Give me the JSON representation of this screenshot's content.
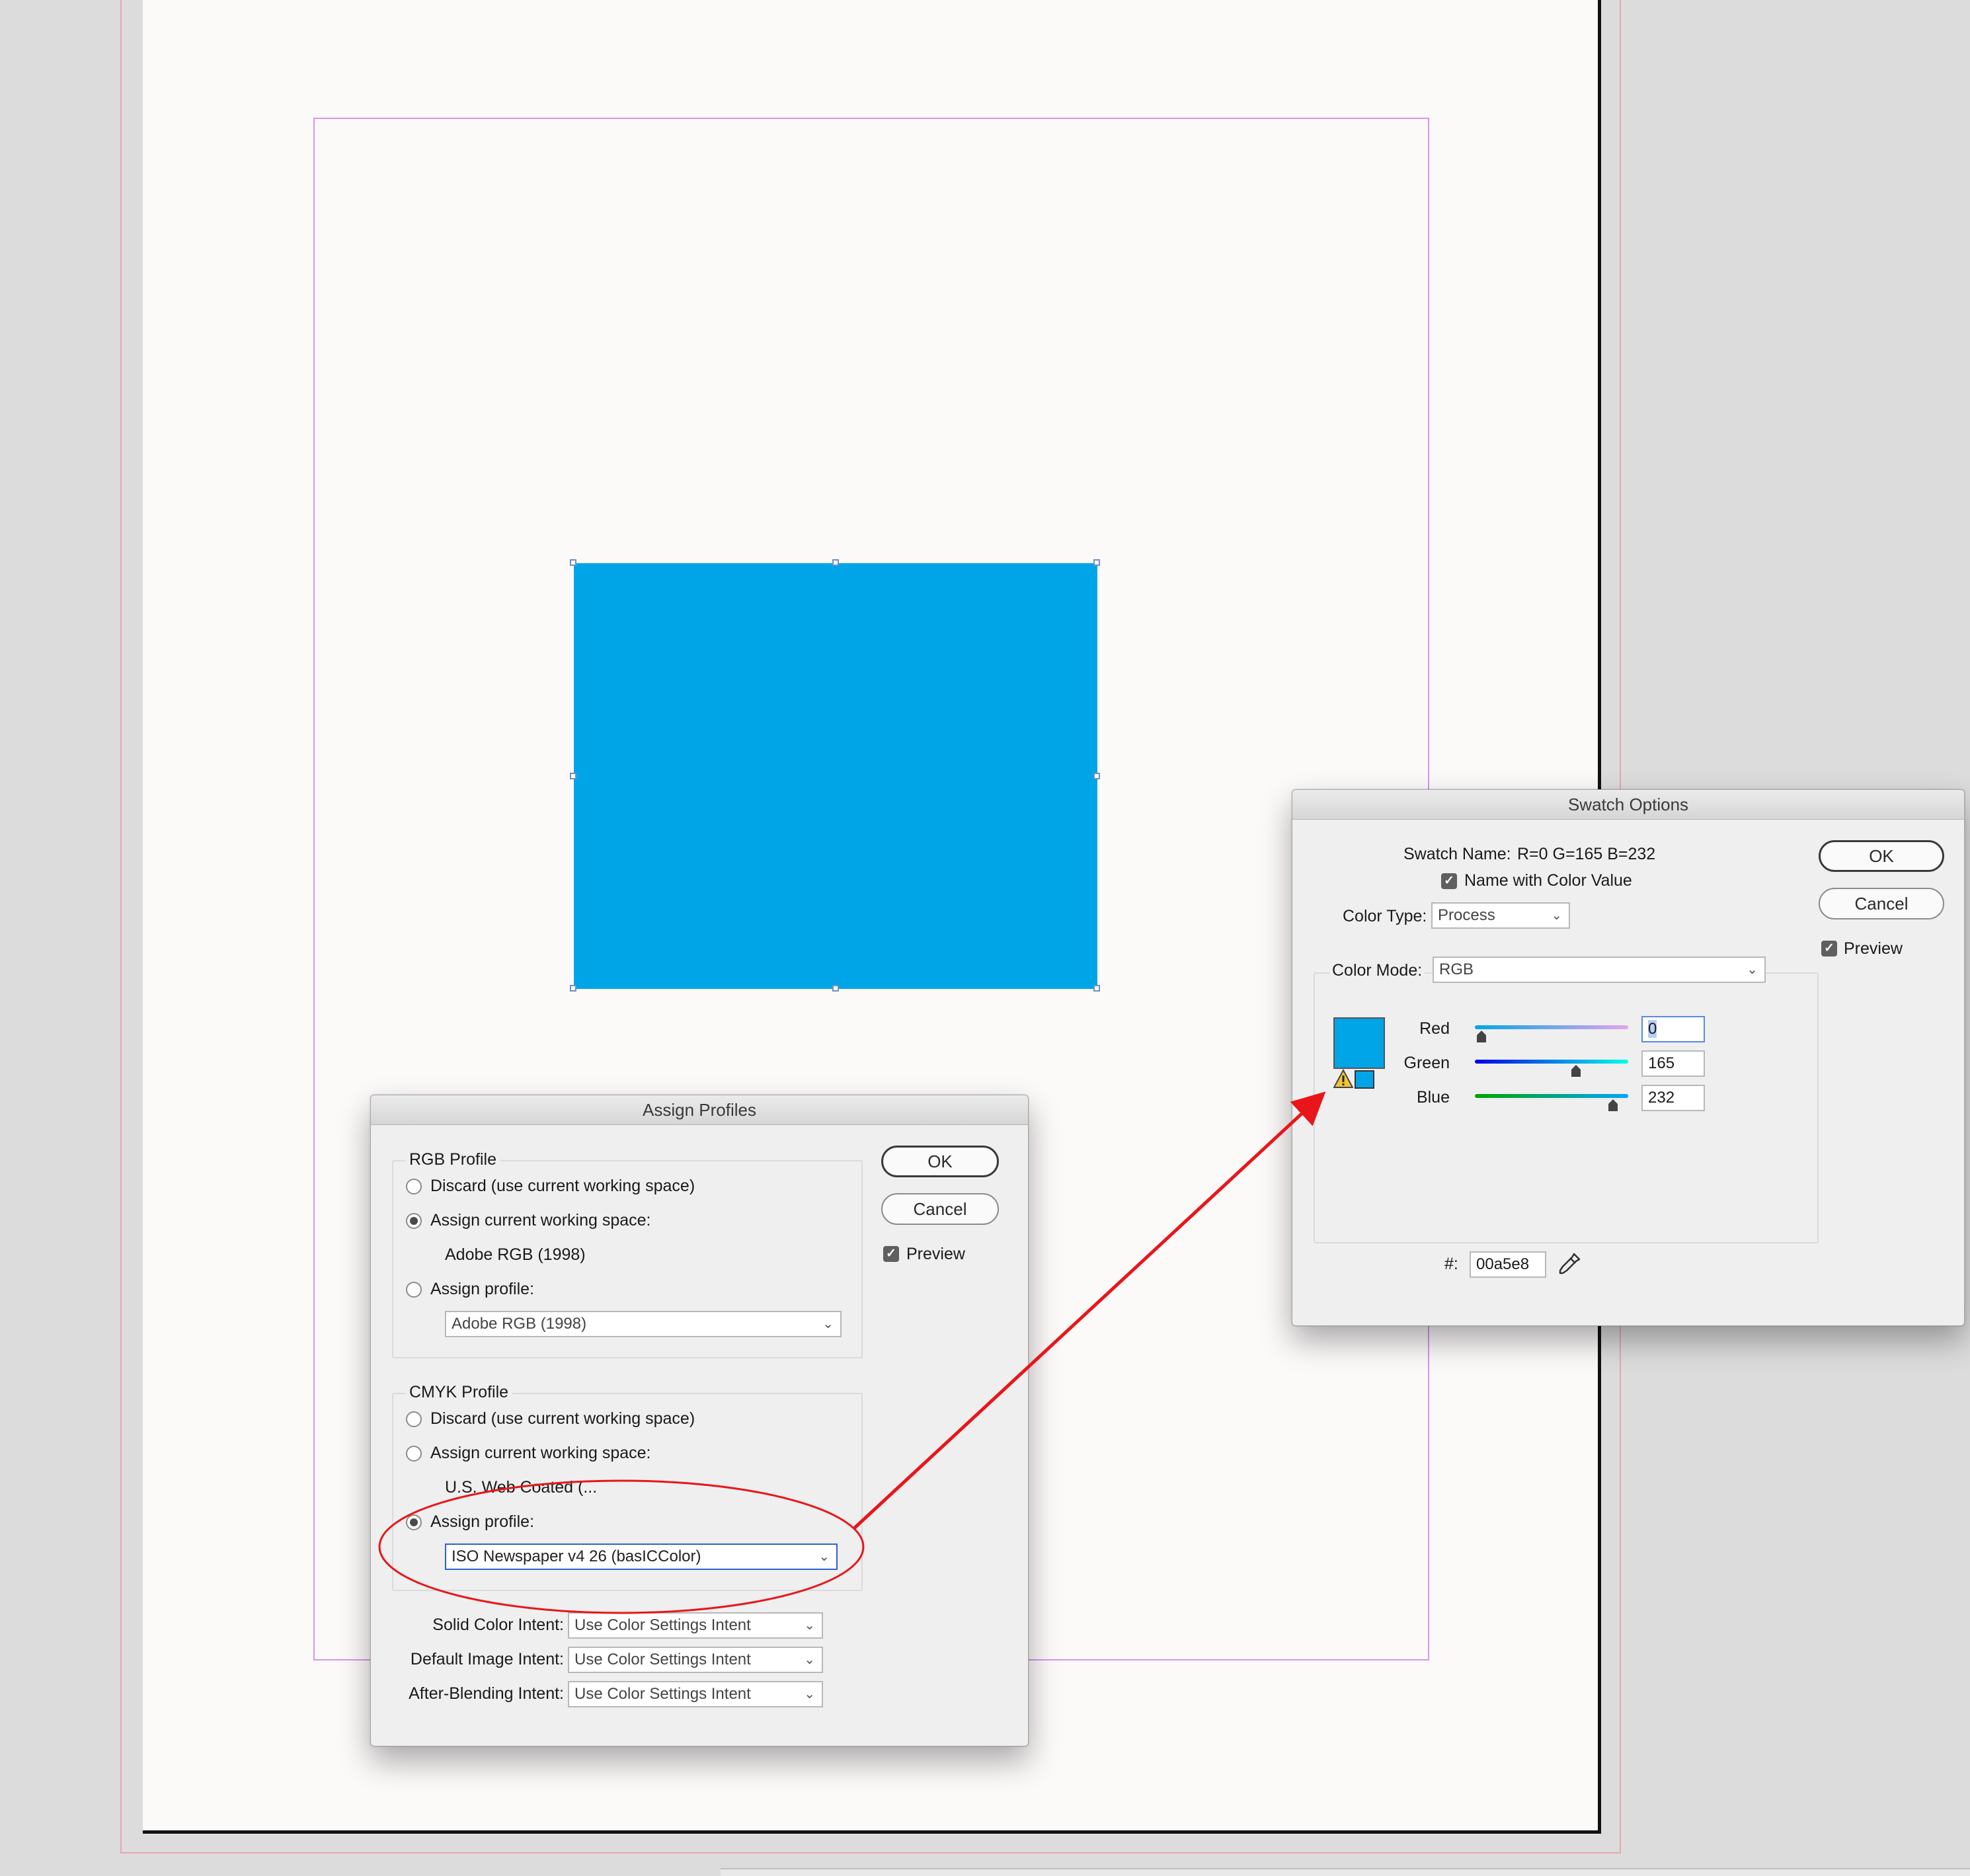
{
  "assign_profiles": {
    "title": "Assign Profiles",
    "rgb": {
      "legend": "RGB Profile",
      "discard": "Discard (use current working space)",
      "assign_current": "Assign current working space:",
      "current_space": "Adobe RGB (1998)",
      "assign_profile": "Assign profile:",
      "profile_value": "Adobe RGB (1998)",
      "selected": "assign_current"
    },
    "cmyk": {
      "legend": "CMYK Profile",
      "discard": "Discard (use current working space)",
      "assign_current": "Assign current working space:",
      "current_space": "U.S. Web Coated (...",
      "assign_profile": "Assign profile:",
      "profile_value": "ISO Newspaper v4 26 (basICColor)",
      "selected": "assign_profile"
    },
    "intents": [
      {
        "label": "Solid Color Intent:",
        "value": "Use Color Settings Intent"
      },
      {
        "label": "Default Image Intent:",
        "value": "Use Color Settings Intent"
      },
      {
        "label": "After-Blending Intent:",
        "value": "Use Color Settings Intent"
      }
    ],
    "ok": "OK",
    "cancel": "Cancel",
    "preview": "Preview",
    "preview_checked": true
  },
  "swatch_options": {
    "title": "Swatch Options",
    "name_label": "Swatch Name:",
    "name_value": "R=0 G=165 B=232",
    "name_with_value": "Name with Color Value",
    "name_with_value_checked": true,
    "color_type_label": "Color Type:",
    "color_type_value": "Process",
    "color_mode_label": "Color Mode:",
    "color_mode_value": "RGB",
    "channels": [
      {
        "label": "Red",
        "value": "0",
        "level": 0
      },
      {
        "label": "Green",
        "value": "165",
        "level": 165
      },
      {
        "label": "Blue",
        "value": "232",
        "level": 232
      }
    ],
    "hex_label": "#:",
    "hex_value": "00a5e8",
    "ok": "OK",
    "cancel": "Cancel",
    "preview": "Preview",
    "preview_checked": true
  },
  "colors": {
    "swatch": "#00a5e8",
    "annotation": "#e8161a",
    "focus": "#2f62d0"
  }
}
